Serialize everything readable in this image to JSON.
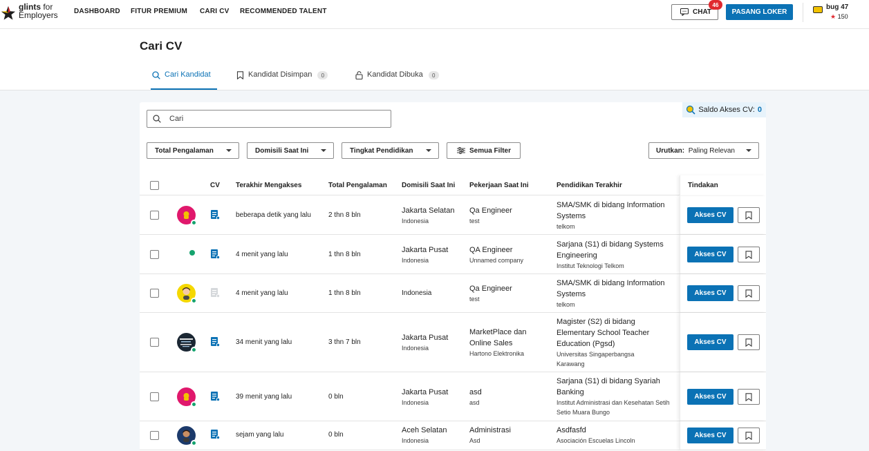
{
  "brand": {
    "line1_bold": "glints",
    "line1_rest": " for",
    "line2": "Employers"
  },
  "nav": {
    "items": [
      "DASHBOARD",
      "FITUR PREMIUM",
      "CARI CV",
      "RECOMMENDED TALENT"
    ]
  },
  "chat": {
    "label": "CHAT",
    "badge": "46"
  },
  "post_job": {
    "label": "PASANG LOKER"
  },
  "user": {
    "name": "bug 47",
    "credits": "150"
  },
  "page": {
    "title": "Cari CV"
  },
  "tabs": [
    {
      "label": "Cari Kandidat",
      "count": ""
    },
    {
      "label": "Kandidat Disimpan",
      "count": "0"
    },
    {
      "label": "Kandidat Dibuka",
      "count": "0"
    }
  ],
  "saldo": {
    "label": "Saldo Akses CV:",
    "value": "0"
  },
  "search": {
    "placeholder": "Cari"
  },
  "filters": [
    "Total Pengalaman",
    "Domisili Saat Ini",
    "Tingkat Pendidikan",
    "Semua Filter"
  ],
  "sort": {
    "label": "Urutkan:",
    "value": "Paling Relevan"
  },
  "table": {
    "headers": [
      "CV",
      "Terakhir Mengakses",
      "Total Pengalaman",
      "Domisili Saat Ini",
      "Pekerjaan Saat Ini",
      "Pendidikan Terakhir",
      "Tindakan"
    ],
    "rows": [
      {
        "last_access": "beberapa detik yang lalu",
        "experience": "2 thn 8 bln",
        "city": "Jakarta Selatan",
        "country": "Indonesia",
        "job": "Qa Engineer",
        "company": "test",
        "education": "SMA/SMK di bidang Information Systems",
        "school": "telkom"
      },
      {
        "last_access": "4 menit yang lalu",
        "experience": "1 thn 8 bln",
        "city": "Jakarta Pusat",
        "country": "Indonesia",
        "job": "QA Engineer",
        "company": "Unnamed company",
        "education": "Sarjana (S1) di bidang Systems Engineering",
        "school": "Institut Teknologi Telkom"
      },
      {
        "last_access": "4 menit yang lalu",
        "experience": "1 thn 8 bln",
        "city": "",
        "country": "Indonesia",
        "job": "Qa Engineer",
        "company": "test",
        "education": "SMA/SMK di bidang Information Systems",
        "school": "telkom"
      },
      {
        "last_access": "34 menit yang lalu",
        "experience": "3 thn 7 bln",
        "city": "Jakarta Pusat",
        "country": "Indonesia",
        "job": "MarketPlace dan Online Sales",
        "company": "Hartono Elektronika",
        "education": "Magister (S2) di bidang Elementary School Teacher Education (Pgsd)",
        "school": "Universitas Singaperbangsa Karawang"
      },
      {
        "last_access": "39 menit yang lalu",
        "experience": "0 bln",
        "city": "Jakarta Pusat",
        "country": "Indonesia",
        "job": "asd",
        "company": "asd",
        "education": "Sarjana (S1) di bidang Syariah Banking",
        "school": "Institut Administrasi dan Kesehatan Setih Setio Muara Bungo"
      },
      {
        "last_access": "sejam yang lalu",
        "experience": "0 bln",
        "city": "Aceh Selatan",
        "country": "Indonesia",
        "job": "Administrasi",
        "company": "Asd",
        "education": "Asdfasfd",
        "school": "Asociación Escuelas Lincoln"
      }
    ],
    "action_label": "Akses CV"
  },
  "colors": {
    "primary": "#0b72b5",
    "badge": "#e0292f",
    "online": "#15a36e"
  },
  "icons": [
    "chat-icon",
    "search-icon",
    "bookmark-icon",
    "lock-icon",
    "sliders-icon",
    "document-icon",
    "coin-icon",
    "star-icon"
  ]
}
